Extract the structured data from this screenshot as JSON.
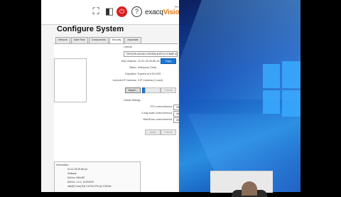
{
  "toolbar": {
    "logo_prefix": "exacq",
    "logo_suffix": "Vision",
    "help_label": "?",
    "minimize_label": "_"
  },
  "page": {
    "title": "Configure System"
  },
  "tabs": [
    "Network",
    "Date/Time",
    "Components",
    "Security",
    "Associate"
  ],
  "license": {
    "section_label": "License",
    "key_value": "TSFK22N-4DY6G-VHGSW-4HS7G-FCM8P-3X",
    "mac_label": "MAC Address",
    "mac_value": "01-0C-29-49-8D-A4",
    "copy_button": "Copy",
    "status_label": "Status",
    "status_value": "Enterprise (Trial)",
    "expiration_label": "Expiration",
    "expiration_value": "Expired at 6.30.2025",
    "ip_cameras_label": "Licensed IP Cameras",
    "ip_cameras_value": "0 IP Cameras (1 used)",
    "import_button": "Import...",
    "export_button": "Export...",
    "apply_button": "Apply",
    "cancel_button": "Cancel"
  },
  "global_settings": {
    "section_label": "Global Settings",
    "rows": [
      {
        "label": "PTZ control timeout",
        "value": "15"
      },
      {
        "label": "2-way audio control timeout",
        "value": "15"
      },
      {
        "label": "VideoPush control timeout",
        "value": "15"
      }
    ],
    "apply_button": "Apply",
    "cancel_button": "Cancel"
  },
  "system_info": {
    "section_label": "Information",
    "lines": [
      "01-0C-29-49-8D-A4",
      "Software",
      "Dell Inc. 0W1487",
      "Dell Inc. 1.0.2, 11/19/2019",
      "Intel(R) Core(TM) i7-8700 CPU @ 3.20GHz"
    ]
  }
}
